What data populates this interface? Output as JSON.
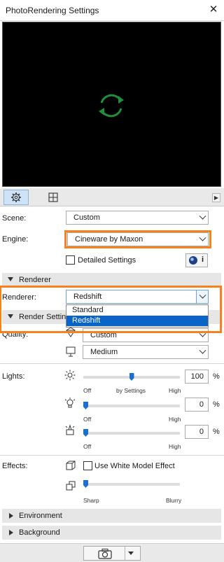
{
  "window": {
    "title": "PhotoRendering Settings"
  },
  "tabs": [
    {
      "name": "settings-tab",
      "icon": "gear-icon"
    },
    {
      "name": "size-tab",
      "icon": "crop-frame-icon"
    }
  ],
  "scene": {
    "label": "Scene:",
    "value": "Custom"
  },
  "engine": {
    "label": "Engine:",
    "value": "Cineware by Maxon"
  },
  "detailed": {
    "label": "Detailed Settings"
  },
  "sections": {
    "renderer": "Renderer",
    "render_settings": "Render Settin",
    "environment": "Environment",
    "background": "Background"
  },
  "renderer": {
    "label": "Renderer:",
    "value": "Redshift",
    "options": [
      "Standard",
      "Redshift"
    ],
    "selected": "Redshift"
  },
  "quality": {
    "label": "Quality:",
    "value1": "Custom",
    "value2": "Medium"
  },
  "lights": {
    "label": "Lights:",
    "sliders": [
      {
        "icon": "sun-icon",
        "value": "100",
        "level": 0.5,
        "ticks": [
          "Off",
          "by Settings",
          "High"
        ]
      },
      {
        "icon": "lamp-icon",
        "value": "0",
        "level": 0.0,
        "ticks": [
          "Off",
          "High"
        ]
      },
      {
        "icon": "torch-icon",
        "value": "0",
        "level": 0.0,
        "ticks": [
          "Off",
          "High"
        ]
      }
    ],
    "unit": "%"
  },
  "effects": {
    "label": "Effects:",
    "white_model": "Use White Model Effect",
    "slider": {
      "ticks": [
        "Sharp",
        "Blurry"
      ],
      "level": 0.0
    }
  },
  "colors": {
    "accent": "#1a6fd1",
    "highlight": "#f5821f",
    "selection": "#0a64c8"
  }
}
